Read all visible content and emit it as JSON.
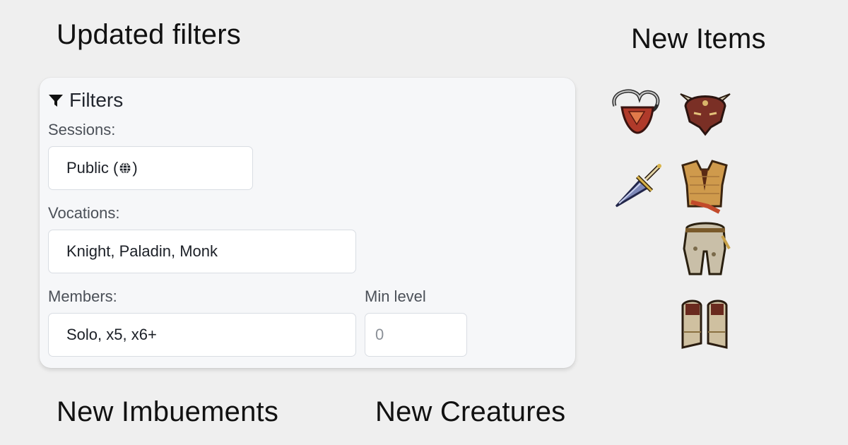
{
  "headings": {
    "updated_filters": "Updated filters",
    "new_items": "New Items",
    "new_imbuements": "New Imbuements",
    "new_creatures": "New Creatures"
  },
  "filters": {
    "title": "Filters",
    "sessions": {
      "label": "Sessions:",
      "value": "Public (",
      "value_suffix": ")",
      "icon": "globe-icon"
    },
    "vocations": {
      "label": "Vocations:",
      "value": "Knight, Paladin, Monk"
    },
    "members": {
      "label": "Members:",
      "value": "Solo, x5, x6+"
    },
    "min_level": {
      "label": "Min level",
      "value": "0"
    }
  },
  "items": [
    {
      "icon": "amulet-icon"
    },
    {
      "icon": "horned-helmet-icon"
    },
    {
      "icon": "dagger-icon"
    },
    {
      "icon": "armor-icon"
    },
    {
      "icon": "legs-icon"
    },
    {
      "icon": "boots-icon"
    }
  ],
  "colors": {
    "background": "#efefef",
    "panel": "#f6f7f9",
    "field_border": "#d9dde3"
  }
}
